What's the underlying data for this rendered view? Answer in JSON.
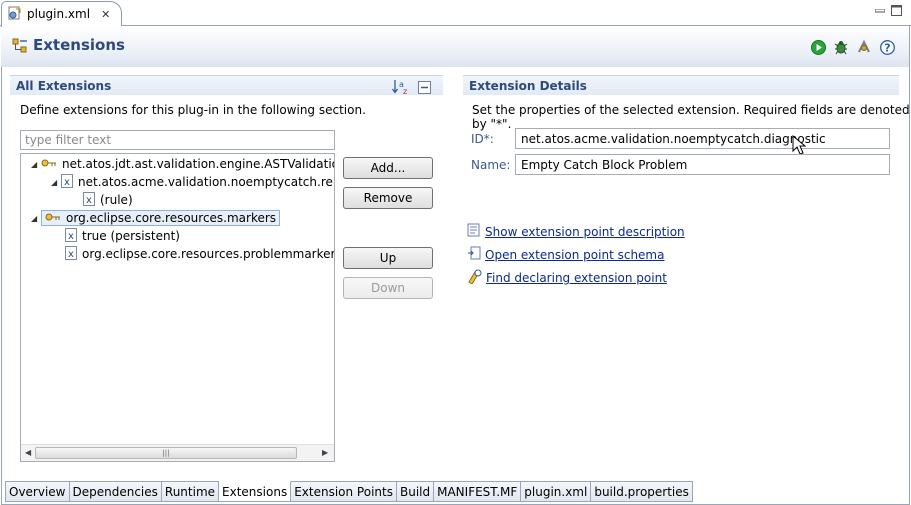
{
  "editor_tab": {
    "label": "plugin.xml"
  },
  "header": {
    "title": "Extensions"
  },
  "all_extensions": {
    "title": "All Extensions",
    "description": "Define extensions for this plug-in in the following section.",
    "filter_placeholder": "type filter text",
    "tree": [
      "net.atos.jdt.ast.validation.engine.ASTValidationRule",
      "net.atos.acme.validation.noemptycatch.reposit",
      "(rule)",
      "org.eclipse.core.resources.markers",
      "true (persistent)",
      "org.eclipse.core.resources.problemmarker (supe"
    ],
    "buttons": {
      "add": "Add...",
      "remove": "Remove",
      "up": "Up",
      "down": "Down"
    }
  },
  "extension_details": {
    "title": "Extension Details",
    "description": "Set the properties of the selected extension. Required fields are denoted by \"*\".",
    "id_label": "ID*:",
    "id_value": "net.atos.acme.validation.noemptycatch.diagnostic",
    "name_label": "Name:",
    "name_value": "Empty Catch Block Problem",
    "links": [
      "Show extension point description",
      "Open extension point schema",
      "Find declaring extension point"
    ]
  },
  "page_tabs": [
    "Overview",
    "Dependencies",
    "Runtime",
    "Extensions",
    "Extension Points",
    "Build",
    "MANIFEST.MF",
    "plugin.xml",
    "build.properties"
  ],
  "active_page_tab": "Extensions",
  "colors": {
    "section_title": "#2c4a7a",
    "link": "#0b2a8c",
    "selection": "#e6effa"
  }
}
